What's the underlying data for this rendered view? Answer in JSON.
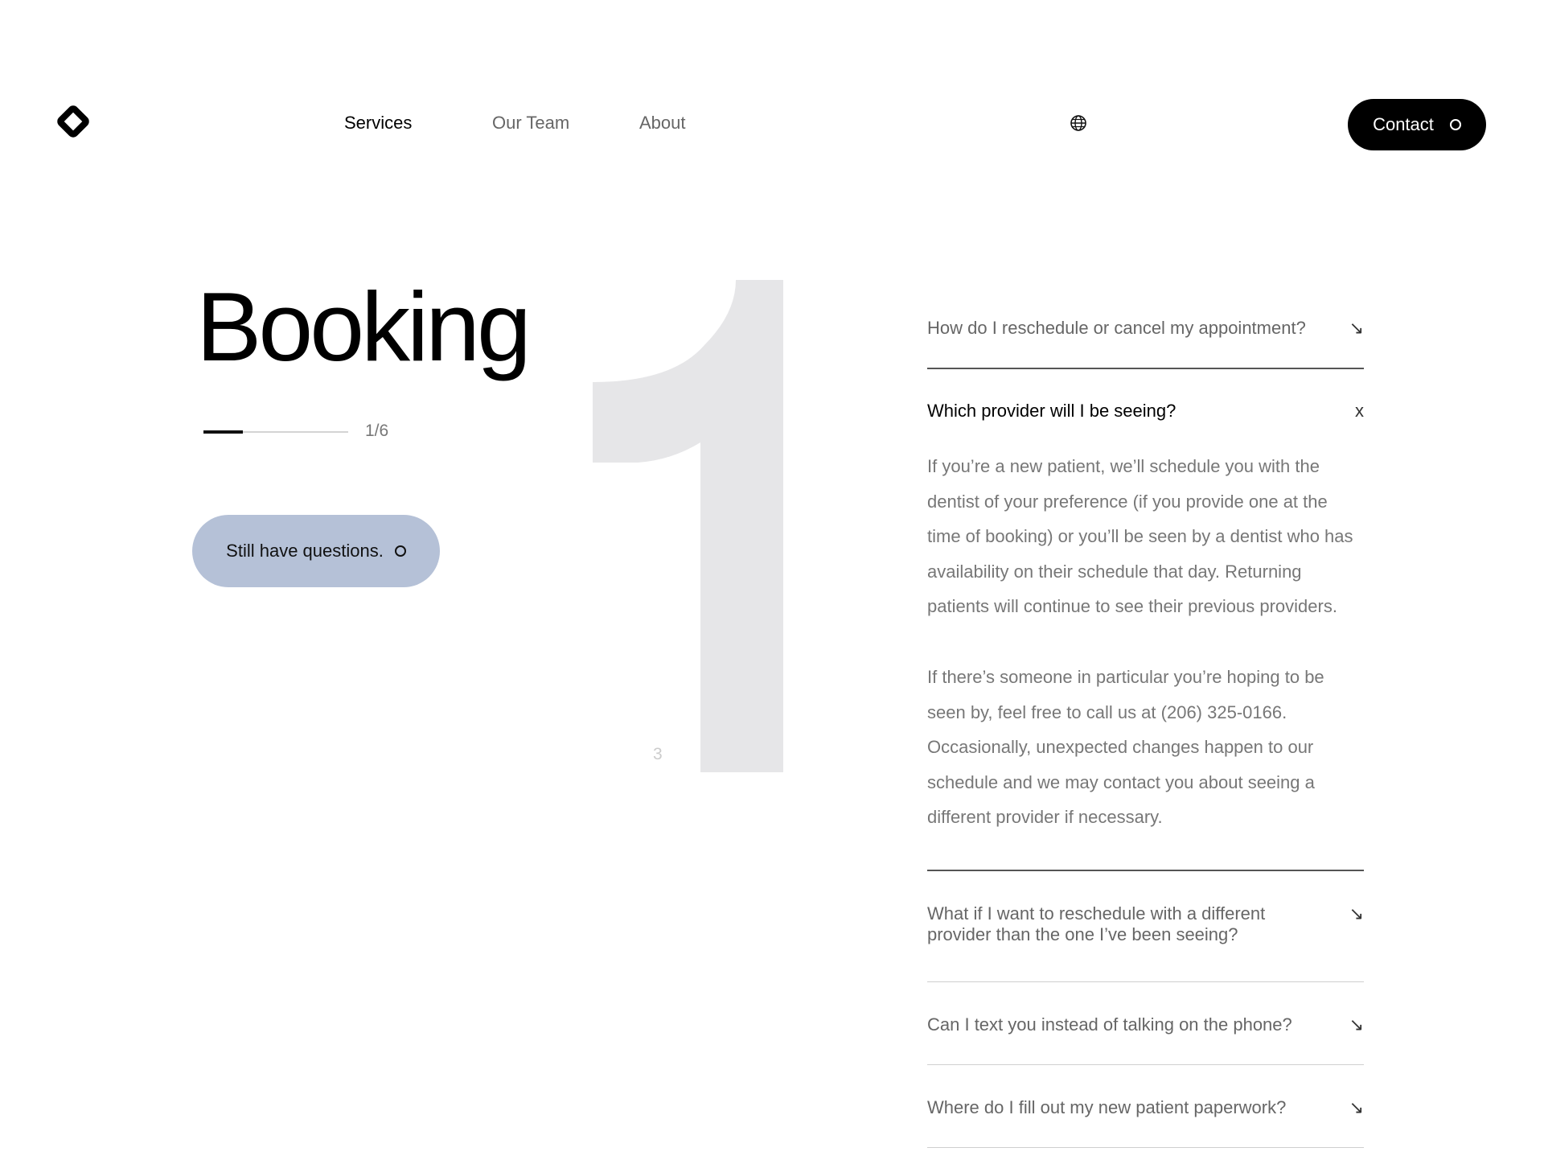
{
  "header": {
    "logo_icon": "diamond-logo-icon",
    "nav": [
      {
        "label": "Services",
        "active": true
      },
      {
        "label": "Our Team",
        "active": false
      },
      {
        "label": "About",
        "active": false
      }
    ],
    "language_icon": "globe-icon",
    "contact_label": "Contact"
  },
  "hero": {
    "title": "Booking",
    "slide_counter": "1/6",
    "slide_progress": 0.27,
    "big_number_icon": "numeral-one-graphic",
    "small_number": "3",
    "questions_label": "Still have questions."
  },
  "faq": {
    "items": [
      {
        "question": "How do I reschedule or cancel my appointment?",
        "icon": "↘",
        "open": false
      },
      {
        "question": "Which provider will I be seeing?",
        "icon": "x",
        "open": true,
        "answer": [
          "If you’re a new patient, we’ll schedule you with the dentist of your preference (if you provide one at the time of booking) or you’ll be seen by a dentist who has availability on their schedule that day. Returning patients will continue to see their previous providers.",
          "If there’s someone in particular you’re hoping to be seen by, feel free to call us at (206) 325-0166. Occasionally, unexpected changes happen to our schedule and we may contact you about seeing a different provider if necessary."
        ]
      },
      {
        "question": "What if I want to reschedule with a different provider than the one I’ve been seeing?",
        "icon": "↘",
        "open": false
      },
      {
        "question": "Can I text you instead of talking on the phone?",
        "icon": "↘",
        "open": false
      },
      {
        "question": "Where do I fill out my new patient paperwork?",
        "icon": "↘",
        "open": false
      }
    ]
  },
  "colors": {
    "accent_button": "#b5c1d7",
    "contact_button": "#000000",
    "giant_numeral": "#e6e6e8"
  }
}
